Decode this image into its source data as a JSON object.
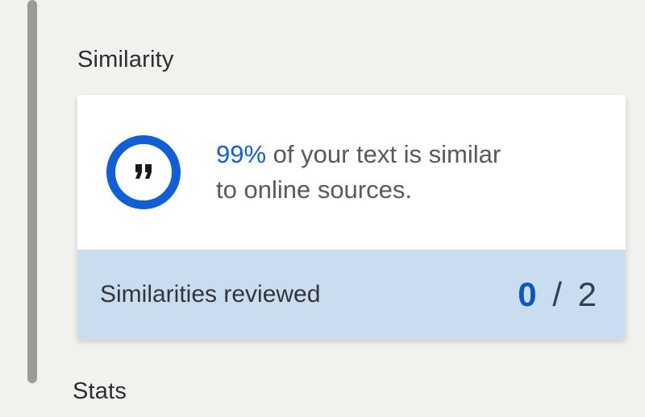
{
  "sections": {
    "similarity": {
      "title": "Similarity"
    },
    "stats": {
      "title": "Stats"
    }
  },
  "similarity_card": {
    "percent": "99%",
    "message_suffix": " of your text is similar",
    "message_line2": "to online sources.",
    "reviewed_label": "Similarities reviewed",
    "reviewed_done": "0",
    "reviewed_sep": " / ",
    "reviewed_total": "2",
    "icon": "quote-icon"
  },
  "colors": {
    "accent": "#0f5fd6",
    "card_footer_bg": "#cadcf0",
    "page_bg": "#f1f1ee"
  }
}
